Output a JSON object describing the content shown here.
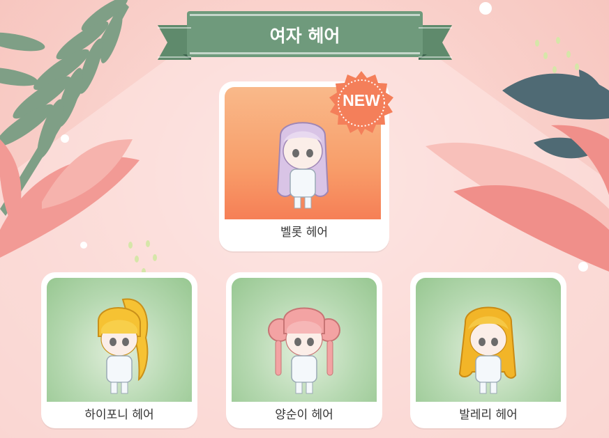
{
  "title": "여자 헤어",
  "featured": {
    "badge": "NEW",
    "label": "벨롯 헤어",
    "hair_color": "#d9c4e6",
    "bg_color": "#f89e6a"
  },
  "items": [
    {
      "label": "하이포니 헤어",
      "hair_color": "#f6c233"
    },
    {
      "label": "양순이 헤어",
      "hair_color": "#f3a3a3"
    },
    {
      "label": "발레리 헤어",
      "hair_color": "#f2b528"
    }
  ],
  "colors": {
    "background": "#f9cfc9",
    "ribbon": "#6f9a7c",
    "card_green": "#b5d8b0",
    "badge": "#f47f5a"
  }
}
